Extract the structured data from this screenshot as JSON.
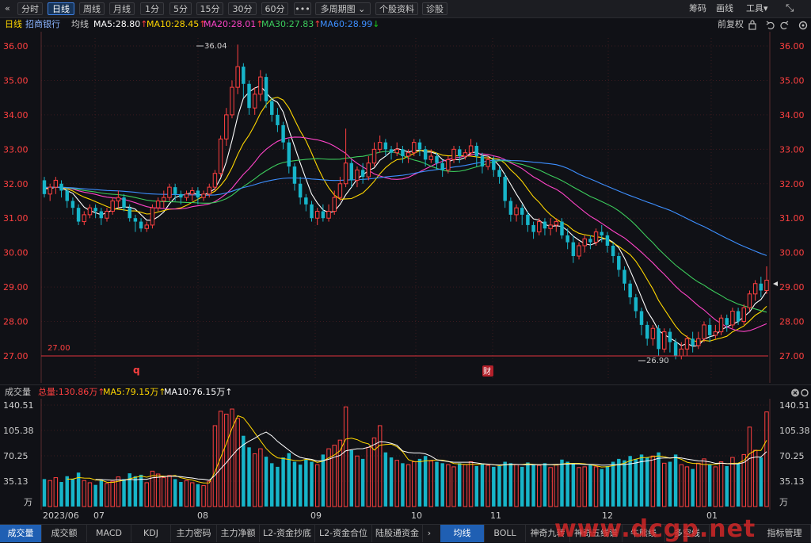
{
  "toolbar": {
    "back_icon": "«",
    "buttons": [
      {
        "label": "分时",
        "active": false
      },
      {
        "label": "日线",
        "active": true
      },
      {
        "label": "周线",
        "active": false
      },
      {
        "label": "月线",
        "active": false
      },
      {
        "label": "1分",
        "active": false
      },
      {
        "label": "5分",
        "active": false
      },
      {
        "label": "15分",
        "active": false
      },
      {
        "label": "30分",
        "active": false
      },
      {
        "label": "60分",
        "active": false
      },
      {
        "label": "•••",
        "active": false
      },
      {
        "label": "多周期图 ⌄",
        "active": false
      },
      {
        "label": "个股资料",
        "active": false
      },
      {
        "label": "诊股",
        "active": false
      }
    ],
    "right": {
      "chips": "筹码",
      "draw": "画线",
      "tools": "工具▾",
      "expand_icon": "⤡"
    }
  },
  "info_bar": {
    "period": "日线",
    "stock": "招商银行",
    "avg_line": "均线",
    "ma": [
      {
        "text": "MA5:28.80",
        "arrow": "↑",
        "color": "#ffffff",
        "arrow_color": "#ff4040"
      },
      {
        "text": "MA10:28.45",
        "arrow": "↑",
        "color": "#ffd700",
        "arrow_color": "#ff4040"
      },
      {
        "text": "MA20:28.01",
        "arrow": "↑",
        "color": "#ff44c8",
        "arrow_color": "#ff4040"
      },
      {
        "text": "MA30:27.83",
        "arrow": "↑",
        "color": "#3ccc5c",
        "arrow_color": "#ff4040"
      },
      {
        "text": "MA60:28.99",
        "arrow": "↓",
        "color": "#3d8fff",
        "arrow_color": "#18c818"
      }
    ],
    "adjust": "前复权",
    "icons": [
      "lock-icon",
      "undo-icon",
      "redo-icon",
      "settings-icon"
    ]
  },
  "price_axis": {
    "labels": [
      "36.00",
      "35.00",
      "34.00",
      "33.00",
      "32.00",
      "31.00",
      "30.00",
      "29.00",
      "28.00",
      "27.00"
    ],
    "high_mark": "36.04",
    "low_mark": "26.90",
    "support_label": "27.00",
    "marker_left": "q",
    "marker_right": "财"
  },
  "volume": {
    "title": "成交量",
    "total": "总量:130.86万↑",
    "ma5": "MA5:79.15万↑",
    "ma10": "MA10:76.15万↑",
    "axis_labels": [
      "140.51",
      "105.38",
      "70.25",
      "35.13",
      "万"
    ]
  },
  "dates": [
    "2023/06",
    "07",
    "08",
    "09",
    "10",
    "11",
    "12",
    "01"
  ],
  "bottom_tabs_left": [
    "成交量",
    "成交额",
    "MACD",
    "KDJ",
    "主力密码",
    "主力净额",
    "L2-资金抄底",
    "L2-资金合位",
    "陆股通资金"
  ],
  "bottom_tabs_right": [
    "均线",
    "BOLL",
    "神奇九转",
    "神奇五线谱",
    "牛熊线",
    "多空线",
    "指标管理"
  ],
  "watermark": "www.dcgp.net",
  "colors": {
    "up": "#ff4040",
    "down": "#17b5c9",
    "grid": "#3a1a1f",
    "bg": "#101116"
  },
  "chart_data": {
    "type": "candlestick",
    "y_range": [
      26.5,
      36.4
    ],
    "volume_max": 140.51,
    "candles": [
      [
        32.1,
        31.7,
        32.2,
        31.6,
        38
      ],
      [
        31.7,
        31.9,
        32.0,
        31.5,
        36
      ],
      [
        31.9,
        32.1,
        32.2,
        31.7,
        40
      ],
      [
        32.0,
        31.8,
        32.1,
        31.6,
        34
      ],
      [
        31.8,
        31.5,
        31.9,
        31.3,
        42
      ],
      [
        31.5,
        31.3,
        31.6,
        31.1,
        38
      ],
      [
        31.3,
        30.9,
        31.4,
        30.8,
        47
      ],
      [
        30.9,
        31.1,
        31.2,
        30.8,
        36
      ],
      [
        31.1,
        31.3,
        31.4,
        31.0,
        33
      ],
      [
        31.3,
        31.2,
        31.4,
        31.0,
        30
      ],
      [
        31.2,
        31.0,
        31.3,
        30.8,
        37
      ],
      [
        31.0,
        31.2,
        31.3,
        30.9,
        32
      ],
      [
        31.2,
        31.5,
        31.6,
        31.1,
        35
      ],
      [
        31.5,
        31.6,
        31.8,
        31.3,
        41
      ],
      [
        31.6,
        31.3,
        31.7,
        31.2,
        38
      ],
      [
        31.3,
        31.0,
        31.4,
        30.9,
        46
      ],
      [
        31.0,
        30.9,
        31.1,
        30.6,
        42
      ],
      [
        30.9,
        30.7,
        31.0,
        30.6,
        44
      ],
      [
        30.7,
        30.8,
        30.9,
        30.6,
        33
      ],
      [
        30.8,
        31.3,
        31.4,
        30.7,
        49
      ],
      [
        31.3,
        31.5,
        31.6,
        31.2,
        45
      ],
      [
        31.5,
        31.6,
        31.8,
        31.3,
        40
      ],
      [
        31.6,
        31.9,
        32.0,
        31.5,
        43
      ],
      [
        31.9,
        31.7,
        32.0,
        31.5,
        38
      ],
      [
        31.7,
        31.6,
        31.8,
        31.4,
        34
      ],
      [
        31.6,
        31.7,
        31.8,
        31.5,
        36
      ],
      [
        31.7,
        31.8,
        31.9,
        31.5,
        33
      ],
      [
        31.8,
        31.6,
        31.9,
        31.4,
        31
      ],
      [
        31.6,
        31.7,
        31.8,
        31.5,
        29
      ],
      [
        31.7,
        31.9,
        32.0,
        31.6,
        35
      ],
      [
        31.9,
        32.3,
        32.4,
        31.8,
        112
      ],
      [
        32.3,
        33.3,
        33.4,
        32.2,
        132
      ],
      [
        33.3,
        34.0,
        34.2,
        33.1,
        128
      ],
      [
        34.0,
        34.8,
        35.0,
        33.9,
        135
      ],
      [
        34.8,
        35.4,
        36.04,
        34.6,
        122
      ],
      [
        35.4,
        34.9,
        35.5,
        34.5,
        98
      ],
      [
        34.9,
        34.2,
        35.0,
        34.0,
        82
      ],
      [
        34.2,
        34.6,
        34.8,
        34.0,
        73
      ],
      [
        34.6,
        35.1,
        35.3,
        34.4,
        80
      ],
      [
        35.1,
        34.4,
        35.2,
        34.2,
        69
      ],
      [
        34.4,
        34.0,
        34.5,
        33.8,
        60
      ],
      [
        34.0,
        33.7,
        34.2,
        33.5,
        55
      ],
      [
        33.7,
        33.2,
        33.8,
        33.0,
        68
      ],
      [
        33.2,
        32.5,
        33.3,
        32.3,
        74
      ],
      [
        32.5,
        32.0,
        32.6,
        31.8,
        62
      ],
      [
        32.0,
        31.6,
        32.2,
        31.4,
        58
      ],
      [
        31.6,
        31.4,
        31.7,
        31.2,
        65
      ],
      [
        31.4,
        31.0,
        31.5,
        30.9,
        62
      ],
      [
        31.0,
        31.2,
        31.3,
        30.8,
        58
      ],
      [
        31.2,
        31.0,
        31.4,
        30.9,
        72
      ],
      [
        31.0,
        31.2,
        31.4,
        30.9,
        80
      ],
      [
        31.2,
        31.6,
        31.8,
        31.1,
        85
      ],
      [
        31.6,
        32.0,
        32.2,
        31.5,
        92
      ],
      [
        32.0,
        32.6,
        33.6,
        31.9,
        138
      ],
      [
        32.6,
        32.1,
        32.7,
        31.9,
        78
      ],
      [
        32.1,
        32.4,
        32.5,
        31.9,
        70
      ],
      [
        32.4,
        32.2,
        32.6,
        32.0,
        66
      ],
      [
        32.2,
        32.6,
        32.8,
        32.1,
        82
      ],
      [
        32.6,
        33.0,
        33.2,
        32.5,
        95
      ],
      [
        33.0,
        33.2,
        33.4,
        32.9,
        112
      ],
      [
        33.2,
        33.0,
        33.3,
        32.8,
        75
      ],
      [
        33.0,
        32.9,
        33.1,
        32.7,
        68
      ],
      [
        32.9,
        33.0,
        33.2,
        32.8,
        64
      ],
      [
        33.0,
        32.8,
        33.1,
        32.6,
        60
      ],
      [
        32.8,
        32.9,
        33.0,
        32.6,
        58
      ],
      [
        32.9,
        33.2,
        33.3,
        32.8,
        62
      ],
      [
        33.2,
        33.0,
        33.3,
        32.8,
        66
      ],
      [
        33.0,
        32.7,
        33.1,
        32.5,
        70
      ],
      [
        32.7,
        32.8,
        33.0,
        32.6,
        63
      ],
      [
        32.8,
        32.6,
        32.9,
        32.4,
        62
      ],
      [
        32.6,
        32.4,
        32.7,
        32.2,
        60
      ],
      [
        32.4,
        32.7,
        32.8,
        32.3,
        58
      ],
      [
        32.7,
        33.0,
        33.1,
        32.6,
        55
      ],
      [
        33.0,
        32.8,
        33.1,
        32.6,
        60
      ],
      [
        32.8,
        32.9,
        33.0,
        32.7,
        58
      ],
      [
        32.9,
        33.1,
        33.3,
        32.8,
        62
      ],
      [
        33.1,
        32.8,
        33.2,
        32.5,
        56
      ],
      [
        32.8,
        32.5,
        32.9,
        32.3,
        59
      ],
      [
        32.5,
        32.7,
        32.8,
        32.4,
        57
      ],
      [
        32.7,
        32.4,
        32.8,
        32.2,
        55
      ],
      [
        32.4,
        32.2,
        32.5,
        32.0,
        56
      ],
      [
        32.2,
        31.5,
        32.3,
        31.3,
        62
      ],
      [
        31.5,
        31.1,
        31.6,
        30.9,
        60
      ],
      [
        31.1,
        31.3,
        31.4,
        30.9,
        58
      ],
      [
        31.3,
        31.1,
        31.4,
        30.8,
        55
      ],
      [
        31.1,
        30.8,
        31.2,
        30.6,
        61
      ],
      [
        30.8,
        30.6,
        30.9,
        30.4,
        58
      ],
      [
        30.6,
        30.9,
        31.0,
        30.5,
        57
      ],
      [
        30.9,
        30.7,
        31.0,
        30.5,
        60
      ],
      [
        30.7,
        30.8,
        31.0,
        30.5,
        54
      ],
      [
        30.8,
        30.9,
        31.0,
        30.6,
        58
      ],
      [
        30.9,
        30.5,
        31.0,
        30.4,
        65
      ],
      [
        30.5,
        30.3,
        30.7,
        30.1,
        62
      ],
      [
        30.3,
        29.9,
        30.5,
        29.7,
        60
      ],
      [
        29.9,
        30.2,
        30.3,
        29.8,
        54
      ],
      [
        30.2,
        30.4,
        30.5,
        30.0,
        55
      ],
      [
        30.4,
        30.3,
        30.5,
        30.1,
        58
      ],
      [
        30.3,
        30.6,
        30.7,
        30.2,
        55
      ],
      [
        30.6,
        30.5,
        30.8,
        30.3,
        52
      ],
      [
        30.5,
        30.2,
        30.6,
        30.0,
        56
      ],
      [
        30.2,
        29.9,
        30.3,
        29.7,
        62
      ],
      [
        29.9,
        29.5,
        30.0,
        29.3,
        66
      ],
      [
        29.5,
        29.1,
        29.6,
        28.9,
        64
      ],
      [
        29.1,
        28.7,
        29.2,
        28.5,
        70
      ],
      [
        28.7,
        28.3,
        28.8,
        28.1,
        66
      ],
      [
        28.3,
        27.9,
        28.4,
        27.6,
        72
      ],
      [
        27.9,
        27.5,
        28.0,
        27.3,
        68
      ],
      [
        27.5,
        27.8,
        27.9,
        27.3,
        70
      ],
      [
        27.8,
        27.2,
        27.9,
        27.0,
        75
      ],
      [
        27.2,
        27.7,
        27.8,
        27.1,
        60
      ],
      [
        27.7,
        27.4,
        27.8,
        27.1,
        62
      ],
      [
        27.4,
        27.0,
        27.5,
        26.9,
        72
      ],
      [
        27.0,
        27.2,
        27.4,
        26.9,
        58
      ],
      [
        27.2,
        27.5,
        27.6,
        27.0,
        55
      ],
      [
        27.5,
        27.3,
        27.7,
        27.1,
        52
      ],
      [
        27.3,
        27.5,
        27.7,
        27.2,
        60
      ],
      [
        27.5,
        27.9,
        28.0,
        27.4,
        66
      ],
      [
        27.9,
        27.6,
        28.1,
        27.4,
        58
      ],
      [
        27.6,
        27.7,
        27.9,
        27.5,
        55
      ],
      [
        27.7,
        28.1,
        28.2,
        27.6,
        62
      ],
      [
        28.1,
        27.9,
        28.2,
        27.7,
        56
      ],
      [
        27.9,
        28.3,
        28.4,
        27.8,
        68
      ],
      [
        28.3,
        28.0,
        28.4,
        27.9,
        60
      ],
      [
        28.0,
        28.4,
        28.5,
        27.9,
        72
      ],
      [
        28.4,
        28.8,
        28.9,
        28.3,
        110
      ],
      [
        28.8,
        29.1,
        29.2,
        28.6,
        78
      ],
      [
        29.1,
        28.9,
        29.3,
        28.7,
        68
      ],
      [
        28.9,
        29.2,
        29.6,
        28.8,
        131
      ]
    ]
  }
}
